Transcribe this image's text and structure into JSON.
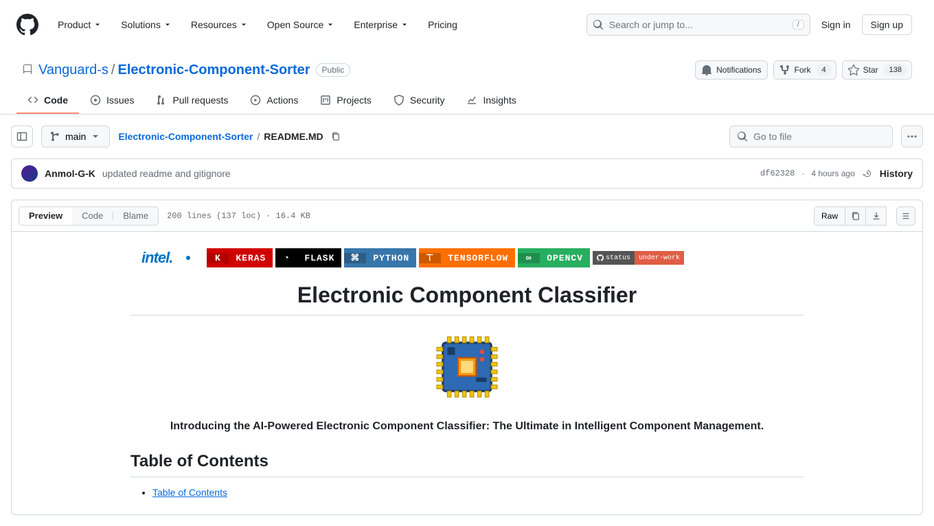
{
  "header": {
    "nav": [
      "Product",
      "Solutions",
      "Resources",
      "Open Source",
      "Enterprise",
      "Pricing"
    ],
    "search_placeholder": "Search or jump to...",
    "search_key": "/",
    "sign_in": "Sign in",
    "sign_up": "Sign up"
  },
  "repo": {
    "owner": "Vanguard-s",
    "name": "Electronic-Component-Sorter",
    "visibility": "Public",
    "actions": {
      "notifications": "Notifications",
      "fork_label": "Fork",
      "fork_count": "4",
      "star_label": "Star",
      "star_count": "138"
    },
    "tabs": [
      "Code",
      "Issues",
      "Pull requests",
      "Actions",
      "Projects",
      "Security",
      "Insights"
    ]
  },
  "file": {
    "branch": "main",
    "crumb_repo": "Electronic-Component-Sorter",
    "crumb_file": "README.MD",
    "go_to_file": "Go to file"
  },
  "commit": {
    "author": "Anmol-G-K",
    "message": "updated readme and gitignore",
    "sha": "df62328",
    "time": "4 hours ago",
    "history": "History"
  },
  "toolbar": {
    "preview": "Preview",
    "code": "Code",
    "blame": "Blame",
    "meta": "200 lines (137 loc) · 16.4 KB",
    "raw": "Raw"
  },
  "readme": {
    "badges": {
      "intel": "intel.",
      "keras": "KERAS",
      "flask": "FLASK",
      "python": "PYTHON",
      "tensorflow": "TENSORFLOW",
      "opencv": "OPENCV",
      "status_l": "status",
      "status_r": "under-work"
    },
    "title": "Electronic Component Classifier",
    "tagline": "Introducing the AI-Powered Electronic Component Classifier: The Ultimate in Intelligent Component Management.",
    "toc_heading": "Table of Contents",
    "toc_first": "Table of Contents"
  }
}
